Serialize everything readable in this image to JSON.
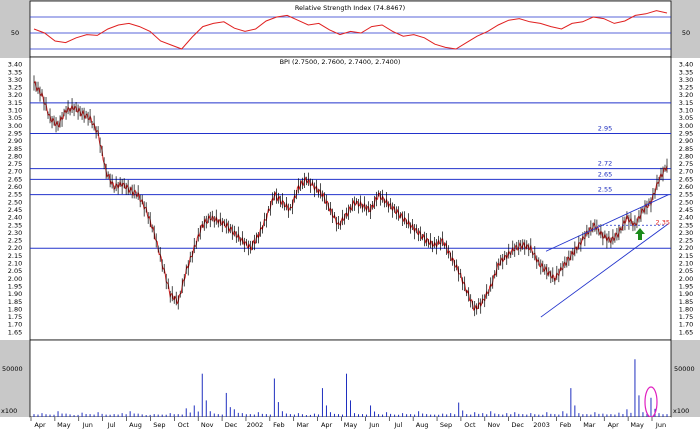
{
  "chart_data": [
    {
      "type": "line",
      "panel": "rsi",
      "title": "Relative Strength Index (74.8467)",
      "yticks": [
        50
      ],
      "ylim": [
        20,
        90
      ],
      "guide_lines": [
        30,
        50,
        70
      ],
      "series_color": "#e02020",
      "series": [
        {
          "values": [
            55,
            50,
            40,
            38,
            44,
            48,
            47,
            55,
            60,
            62,
            58,
            52,
            40,
            35,
            30,
            45,
            58,
            62,
            64,
            56,
            52,
            55,
            65,
            70,
            72,
            66,
            60,
            62,
            54,
            48,
            52,
            50,
            58,
            60,
            52,
            46,
            48,
            44,
            36,
            32,
            30,
            38,
            46,
            52,
            60,
            66,
            68,
            64,
            62,
            58,
            55,
            62,
            64,
            70,
            68,
            62,
            65,
            72,
            74,
            78,
            75
          ]
        }
      ]
    },
    {
      "type": "line",
      "panel": "price",
      "title": "BPI (2.7500, 2.7600, 2.7400, 2.7400)",
      "ylim": [
        1.6,
        3.45
      ],
      "yticks": [
        "1.65",
        "1.70",
        "1.75",
        "1.80",
        "1.85",
        "1.90",
        "1.95",
        "2.00",
        "2.05",
        "2.10",
        "2.15",
        "2.20",
        "2.25",
        "2.30",
        "2.35",
        "2.40",
        "2.45",
        "2.50",
        "2.55",
        "2.60",
        "2.65",
        "2.70",
        "2.75",
        "2.80",
        "2.85",
        "2.90",
        "2.95",
        "3.00",
        "3.05",
        "3.10",
        "3.15",
        "3.20",
        "3.25",
        "3.30",
        "3.35",
        "3.40"
      ],
      "xticks": [
        "Apr",
        "May",
        "Jun",
        "Jul",
        "Aug",
        "Sep",
        "Oct",
        "Nov",
        "Dec",
        "2002",
        "Feb",
        "Mar",
        "Apr",
        "May",
        "Jun",
        "Jul",
        "Aug",
        "Sep",
        "Oct",
        "Nov",
        "Dec",
        "2003",
        "Feb",
        "Mar",
        "Apr",
        "May",
        "Jun"
      ],
      "horizontal_levels": [
        3.15,
        2.95,
        2.72,
        2.65,
        2.55,
        2.2
      ],
      "level_labels": [
        {
          "value": 2.95,
          "text": "2.95"
        },
        {
          "value": 2.72,
          "text": "2.72"
        },
        {
          "value": 2.65,
          "text": "2.65"
        },
        {
          "value": 2.55,
          "text": "2.55"
        }
      ],
      "annotation": {
        "text": "2.35",
        "value": 2.35,
        "color": "#e02020"
      },
      "dotted_level": 2.35,
      "series_color": "#e02020",
      "series": [
        {
          "name": "BPI",
          "values": [
            3.28,
            3.2,
            3.05,
            3.0,
            3.1,
            3.12,
            3.08,
            3.05,
            2.95,
            2.7,
            2.6,
            2.62,
            2.58,
            2.55,
            2.45,
            2.3,
            2.1,
            1.9,
            1.85,
            2.05,
            2.2,
            2.35,
            2.4,
            2.38,
            2.35,
            2.3,
            2.25,
            2.2,
            2.28,
            2.4,
            2.55,
            2.5,
            2.45,
            2.6,
            2.65,
            2.6,
            2.55,
            2.45,
            2.35,
            2.42,
            2.5,
            2.48,
            2.45,
            2.55,
            2.5,
            2.45,
            2.4,
            2.35,
            2.3,
            2.25,
            2.22,
            2.25,
            2.15,
            2.05,
            1.92,
            1.8,
            1.85,
            1.95,
            2.1,
            2.15,
            2.2,
            2.22,
            2.2,
            2.1,
            2.05,
            2.0,
            2.08,
            2.15,
            2.22,
            2.3,
            2.35,
            2.28,
            2.25,
            2.3,
            2.4,
            2.35,
            2.45,
            2.5,
            2.65,
            2.74
          ]
        }
      ],
      "trend_channel": {
        "upper": [
          {
            "x": 0.805,
            "y": 2.18
          },
          {
            "x": 0.996,
            "y": 2.55
          }
        ],
        "lower": [
          {
            "x": 0.797,
            "y": 1.75
          },
          {
            "x": 0.996,
            "y": 2.36
          }
        ]
      },
      "arrow": {
        "direction": "up",
        "color": "#1a8a1a",
        "value": 2.28
      }
    },
    {
      "type": "bar",
      "panel": "volume",
      "yticks": [
        "50000"
      ],
      "ylim": [
        0,
        80000
      ],
      "axis_unit_label": "x100",
      "series_color": "#1f2fbf",
      "series": [
        {
          "values": [
            3000,
            4000,
            2500,
            6000,
            3500,
            2000,
            4500,
            3000,
            5000,
            2500,
            3000,
            4000,
            6000,
            3500,
            2000,
            3000,
            2500,
            4000,
            3000,
            9000,
            12000,
            45000,
            6000,
            3000,
            25000,
            8000,
            4000,
            3000,
            5000,
            3000,
            40000,
            6000,
            3000,
            4000,
            2000,
            3500,
            30000,
            5000,
            3000,
            45000,
            4000,
            3000,
            12000,
            3000,
            5000,
            2500,
            4000,
            3000,
            6000,
            3000,
            2500,
            3500,
            4000,
            15000,
            3000,
            5000,
            4000,
            6000,
            3000,
            4000,
            5000,
            3000,
            4000,
            2500,
            5000,
            3000,
            6000,
            30000,
            4000,
            3000,
            5000,
            3500,
            3000,
            4500,
            8000,
            60000,
            5000,
            20000,
            4000,
            3000
          ]
        }
      ],
      "highlight_ellipse": {
        "color": "#e020c0"
      }
    }
  ]
}
